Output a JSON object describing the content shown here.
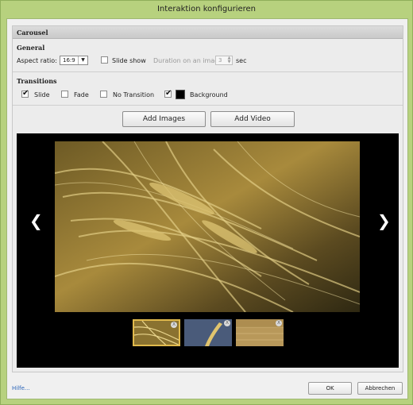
{
  "window": {
    "title": "Interaktion konfigurieren"
  },
  "panel": {
    "header": "Carousel"
  },
  "general": {
    "title": "General",
    "aspect_ratio_label": "Aspect ratio:",
    "aspect_ratio_value": "16:9",
    "slide_show_label": "Slide show",
    "slide_show_checked": false,
    "duration_label": "Duration on an image",
    "duration_value": "3",
    "duration_unit": "sec"
  },
  "transitions": {
    "title": "Transitions",
    "slide_label": "Slide",
    "slide_checked": true,
    "fade_label": "Fade",
    "fade_checked": false,
    "no_transition_label": "No Transition",
    "no_transition_checked": false,
    "background_label": "Background",
    "background_checked": true,
    "background_color": "#000000"
  },
  "buttons": {
    "add_images": "Add Images",
    "add_video": "Add Video"
  },
  "carousel": {
    "prev_icon": "chevron-left-icon",
    "next_icon": "chevron-right-icon",
    "thumb_remove_glyph": "X",
    "selected_thumb_index": 0
  },
  "footer": {
    "help": "Hilfe...",
    "ok": "OK",
    "cancel": "Abbrechen"
  },
  "colors": {
    "window_frame": "#b7d17e",
    "selected_thumb": "#e0b94c",
    "link": "#2a64b8"
  }
}
